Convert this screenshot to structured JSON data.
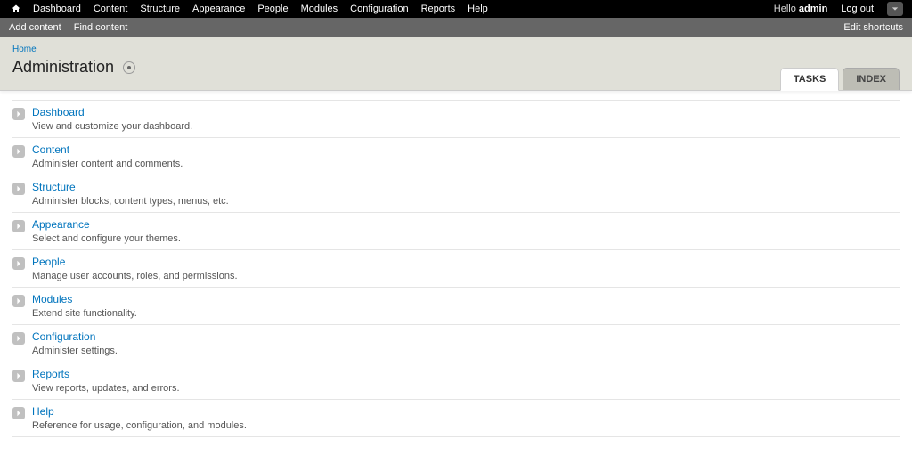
{
  "toolbar": {
    "menu": [
      "Dashboard",
      "Content",
      "Structure",
      "Appearance",
      "People",
      "Modules",
      "Configuration",
      "Reports",
      "Help"
    ],
    "hello_prefix": "Hello ",
    "username": "admin",
    "logout": "Log out"
  },
  "shortcutbar": {
    "links": [
      "Add content",
      "Find content"
    ],
    "edit": "Edit shortcuts"
  },
  "breadcrumb": {
    "home": "Home"
  },
  "page_title": "Administration",
  "tabs": {
    "active": "TASKS",
    "inactive": "INDEX"
  },
  "items": [
    {
      "title": "Dashboard",
      "desc": "View and customize your dashboard."
    },
    {
      "title": "Content",
      "desc": "Administer content and comments."
    },
    {
      "title": "Structure",
      "desc": "Administer blocks, content types, menus, etc."
    },
    {
      "title": "Appearance",
      "desc": "Select and configure your themes."
    },
    {
      "title": "People",
      "desc": "Manage user accounts, roles, and permissions."
    },
    {
      "title": "Modules",
      "desc": "Extend site functionality."
    },
    {
      "title": "Configuration",
      "desc": "Administer settings."
    },
    {
      "title": "Reports",
      "desc": "View reports, updates, and errors."
    },
    {
      "title": "Help",
      "desc": "Reference for usage, configuration, and modules."
    }
  ]
}
